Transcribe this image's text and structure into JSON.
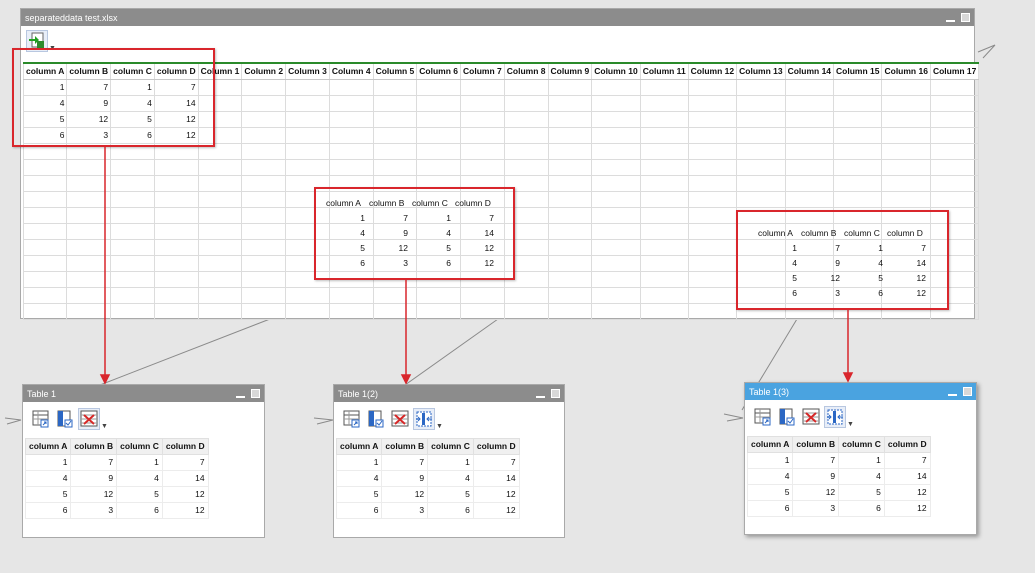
{
  "colors": {
    "titlebar": "#8c8c8c",
    "titlebar_active": "#4aa3e0",
    "highlight": "#d9262c",
    "header_rule": "#2a8a2a"
  },
  "main_window": {
    "title": "separateddata test.xlsx",
    "toolbar": [
      {
        "icon": "import-data-icon"
      }
    ],
    "columns": [
      "column A",
      "column B",
      "column C",
      "column D",
      "Column 1",
      "Column 2",
      "Column 3",
      "Column 4",
      "Column 5",
      "Column 6",
      "Column 7",
      "Column 8",
      "Column 9",
      "Column 10",
      "Column 11",
      "Column 12",
      "Column 13",
      "Column 14",
      "Column 15",
      "Column 16",
      "Column 17"
    ],
    "rows": [
      [
        "1",
        "7",
        "1",
        "7"
      ],
      [
        "4",
        "9",
        "4",
        "14"
      ],
      [
        "5",
        "12",
        "5",
        "12"
      ],
      [
        "6",
        "3",
        "6",
        "12"
      ]
    ]
  },
  "middle_block": {
    "headers": [
      "column A",
      "column B",
      "column C",
      "column D"
    ],
    "rows": [
      [
        "1",
        "7",
        "1",
        "7"
      ],
      [
        "4",
        "9",
        "4",
        "14"
      ],
      [
        "5",
        "12",
        "5",
        "12"
      ],
      [
        "6",
        "3",
        "6",
        "12"
      ]
    ]
  },
  "right_block": {
    "headers": [
      "column A",
      "column B",
      "column C",
      "column D"
    ],
    "rows": [
      [
        "1",
        "7",
        "1",
        "7"
      ],
      [
        "4",
        "9",
        "4",
        "14"
      ],
      [
        "5",
        "12",
        "5",
        "12"
      ],
      [
        "6",
        "3",
        "6",
        "12"
      ]
    ]
  },
  "table_windows": [
    {
      "title": "Table 1",
      "toolbar": [
        {
          "icon": "table-view-icon"
        },
        {
          "icon": "column-select-icon"
        },
        {
          "icon": "delete-table-icon"
        }
      ],
      "headers": [
        "column A",
        "column B",
        "column C",
        "column D"
      ],
      "rows": [
        [
          "1",
          "7",
          "1",
          "7"
        ],
        [
          "4",
          "9",
          "4",
          "14"
        ],
        [
          "5",
          "12",
          "5",
          "12"
        ],
        [
          "6",
          "3",
          "6",
          "12"
        ]
      ]
    },
    {
      "title": "Table 1(2)",
      "toolbar": [
        {
          "icon": "table-view-icon"
        },
        {
          "icon": "column-select-icon"
        },
        {
          "icon": "delete-table-icon"
        },
        {
          "icon": "split-columns-icon"
        }
      ],
      "headers": [
        "column A",
        "column B",
        "column C",
        "column D"
      ],
      "rows": [
        [
          "1",
          "7",
          "1",
          "7"
        ],
        [
          "4",
          "9",
          "4",
          "14"
        ],
        [
          "5",
          "12",
          "5",
          "12"
        ],
        [
          "6",
          "3",
          "6",
          "12"
        ]
      ]
    },
    {
      "title": "Table 1(3)",
      "toolbar": [
        {
          "icon": "table-view-icon"
        },
        {
          "icon": "column-select-icon"
        },
        {
          "icon": "delete-table-icon"
        },
        {
          "icon": "split-columns-icon"
        }
      ],
      "headers": [
        "column A",
        "column B",
        "column C",
        "column D"
      ],
      "rows": [
        [
          "1",
          "7",
          "1",
          "7"
        ],
        [
          "4",
          "9",
          "4",
          "14"
        ],
        [
          "5",
          "12",
          "5",
          "12"
        ],
        [
          "6",
          "3",
          "6",
          "12"
        ]
      ]
    }
  ]
}
